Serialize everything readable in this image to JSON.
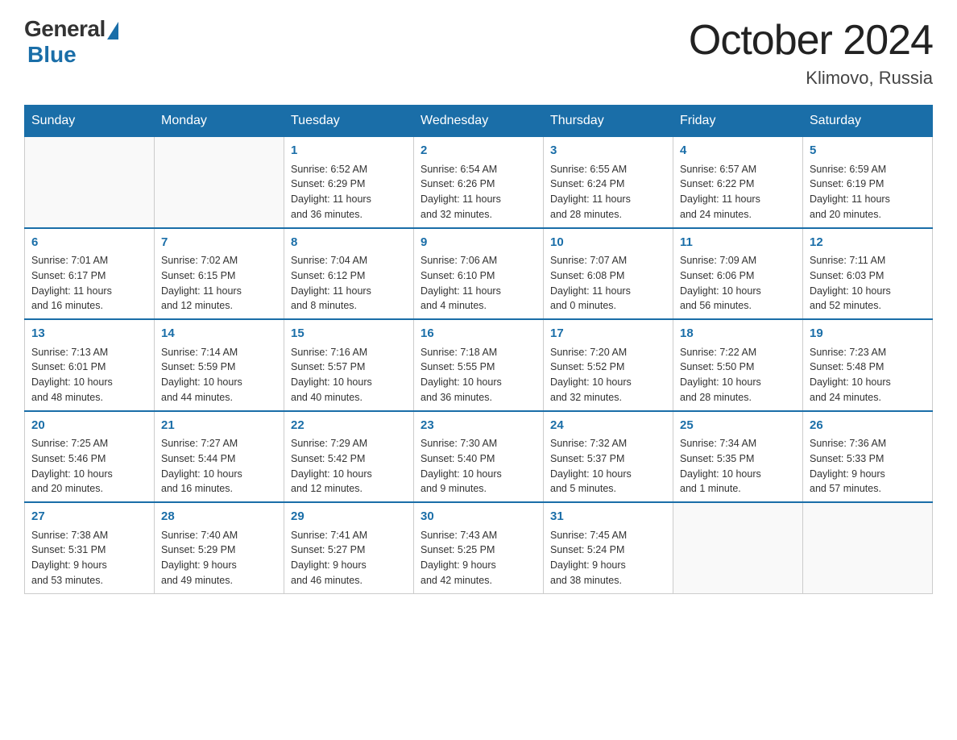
{
  "logo": {
    "general": "General",
    "blue": "Blue",
    "triangle_color": "#1a6ea8"
  },
  "header": {
    "title": "October 2024",
    "location": "Klimovo, Russia"
  },
  "weekdays": [
    "Sunday",
    "Monday",
    "Tuesday",
    "Wednesday",
    "Thursday",
    "Friday",
    "Saturday"
  ],
  "weeks": [
    [
      {
        "day": "",
        "info": ""
      },
      {
        "day": "",
        "info": ""
      },
      {
        "day": "1",
        "info": "Sunrise: 6:52 AM\nSunset: 6:29 PM\nDaylight: 11 hours\nand 36 minutes."
      },
      {
        "day": "2",
        "info": "Sunrise: 6:54 AM\nSunset: 6:26 PM\nDaylight: 11 hours\nand 32 minutes."
      },
      {
        "day": "3",
        "info": "Sunrise: 6:55 AM\nSunset: 6:24 PM\nDaylight: 11 hours\nand 28 minutes."
      },
      {
        "day": "4",
        "info": "Sunrise: 6:57 AM\nSunset: 6:22 PM\nDaylight: 11 hours\nand 24 minutes."
      },
      {
        "day": "5",
        "info": "Sunrise: 6:59 AM\nSunset: 6:19 PM\nDaylight: 11 hours\nand 20 minutes."
      }
    ],
    [
      {
        "day": "6",
        "info": "Sunrise: 7:01 AM\nSunset: 6:17 PM\nDaylight: 11 hours\nand 16 minutes."
      },
      {
        "day": "7",
        "info": "Sunrise: 7:02 AM\nSunset: 6:15 PM\nDaylight: 11 hours\nand 12 minutes."
      },
      {
        "day": "8",
        "info": "Sunrise: 7:04 AM\nSunset: 6:12 PM\nDaylight: 11 hours\nand 8 minutes."
      },
      {
        "day": "9",
        "info": "Sunrise: 7:06 AM\nSunset: 6:10 PM\nDaylight: 11 hours\nand 4 minutes."
      },
      {
        "day": "10",
        "info": "Sunrise: 7:07 AM\nSunset: 6:08 PM\nDaylight: 11 hours\nand 0 minutes."
      },
      {
        "day": "11",
        "info": "Sunrise: 7:09 AM\nSunset: 6:06 PM\nDaylight: 10 hours\nand 56 minutes."
      },
      {
        "day": "12",
        "info": "Sunrise: 7:11 AM\nSunset: 6:03 PM\nDaylight: 10 hours\nand 52 minutes."
      }
    ],
    [
      {
        "day": "13",
        "info": "Sunrise: 7:13 AM\nSunset: 6:01 PM\nDaylight: 10 hours\nand 48 minutes."
      },
      {
        "day": "14",
        "info": "Sunrise: 7:14 AM\nSunset: 5:59 PM\nDaylight: 10 hours\nand 44 minutes."
      },
      {
        "day": "15",
        "info": "Sunrise: 7:16 AM\nSunset: 5:57 PM\nDaylight: 10 hours\nand 40 minutes."
      },
      {
        "day": "16",
        "info": "Sunrise: 7:18 AM\nSunset: 5:55 PM\nDaylight: 10 hours\nand 36 minutes."
      },
      {
        "day": "17",
        "info": "Sunrise: 7:20 AM\nSunset: 5:52 PM\nDaylight: 10 hours\nand 32 minutes."
      },
      {
        "day": "18",
        "info": "Sunrise: 7:22 AM\nSunset: 5:50 PM\nDaylight: 10 hours\nand 28 minutes."
      },
      {
        "day": "19",
        "info": "Sunrise: 7:23 AM\nSunset: 5:48 PM\nDaylight: 10 hours\nand 24 minutes."
      }
    ],
    [
      {
        "day": "20",
        "info": "Sunrise: 7:25 AM\nSunset: 5:46 PM\nDaylight: 10 hours\nand 20 minutes."
      },
      {
        "day": "21",
        "info": "Sunrise: 7:27 AM\nSunset: 5:44 PM\nDaylight: 10 hours\nand 16 minutes."
      },
      {
        "day": "22",
        "info": "Sunrise: 7:29 AM\nSunset: 5:42 PM\nDaylight: 10 hours\nand 12 minutes."
      },
      {
        "day": "23",
        "info": "Sunrise: 7:30 AM\nSunset: 5:40 PM\nDaylight: 10 hours\nand 9 minutes."
      },
      {
        "day": "24",
        "info": "Sunrise: 7:32 AM\nSunset: 5:37 PM\nDaylight: 10 hours\nand 5 minutes."
      },
      {
        "day": "25",
        "info": "Sunrise: 7:34 AM\nSunset: 5:35 PM\nDaylight: 10 hours\nand 1 minute."
      },
      {
        "day": "26",
        "info": "Sunrise: 7:36 AM\nSunset: 5:33 PM\nDaylight: 9 hours\nand 57 minutes."
      }
    ],
    [
      {
        "day": "27",
        "info": "Sunrise: 7:38 AM\nSunset: 5:31 PM\nDaylight: 9 hours\nand 53 minutes."
      },
      {
        "day": "28",
        "info": "Sunrise: 7:40 AM\nSunset: 5:29 PM\nDaylight: 9 hours\nand 49 minutes."
      },
      {
        "day": "29",
        "info": "Sunrise: 7:41 AM\nSunset: 5:27 PM\nDaylight: 9 hours\nand 46 minutes."
      },
      {
        "day": "30",
        "info": "Sunrise: 7:43 AM\nSunset: 5:25 PM\nDaylight: 9 hours\nand 42 minutes."
      },
      {
        "day": "31",
        "info": "Sunrise: 7:45 AM\nSunset: 5:24 PM\nDaylight: 9 hours\nand 38 minutes."
      },
      {
        "day": "",
        "info": ""
      },
      {
        "day": "",
        "info": ""
      }
    ]
  ]
}
